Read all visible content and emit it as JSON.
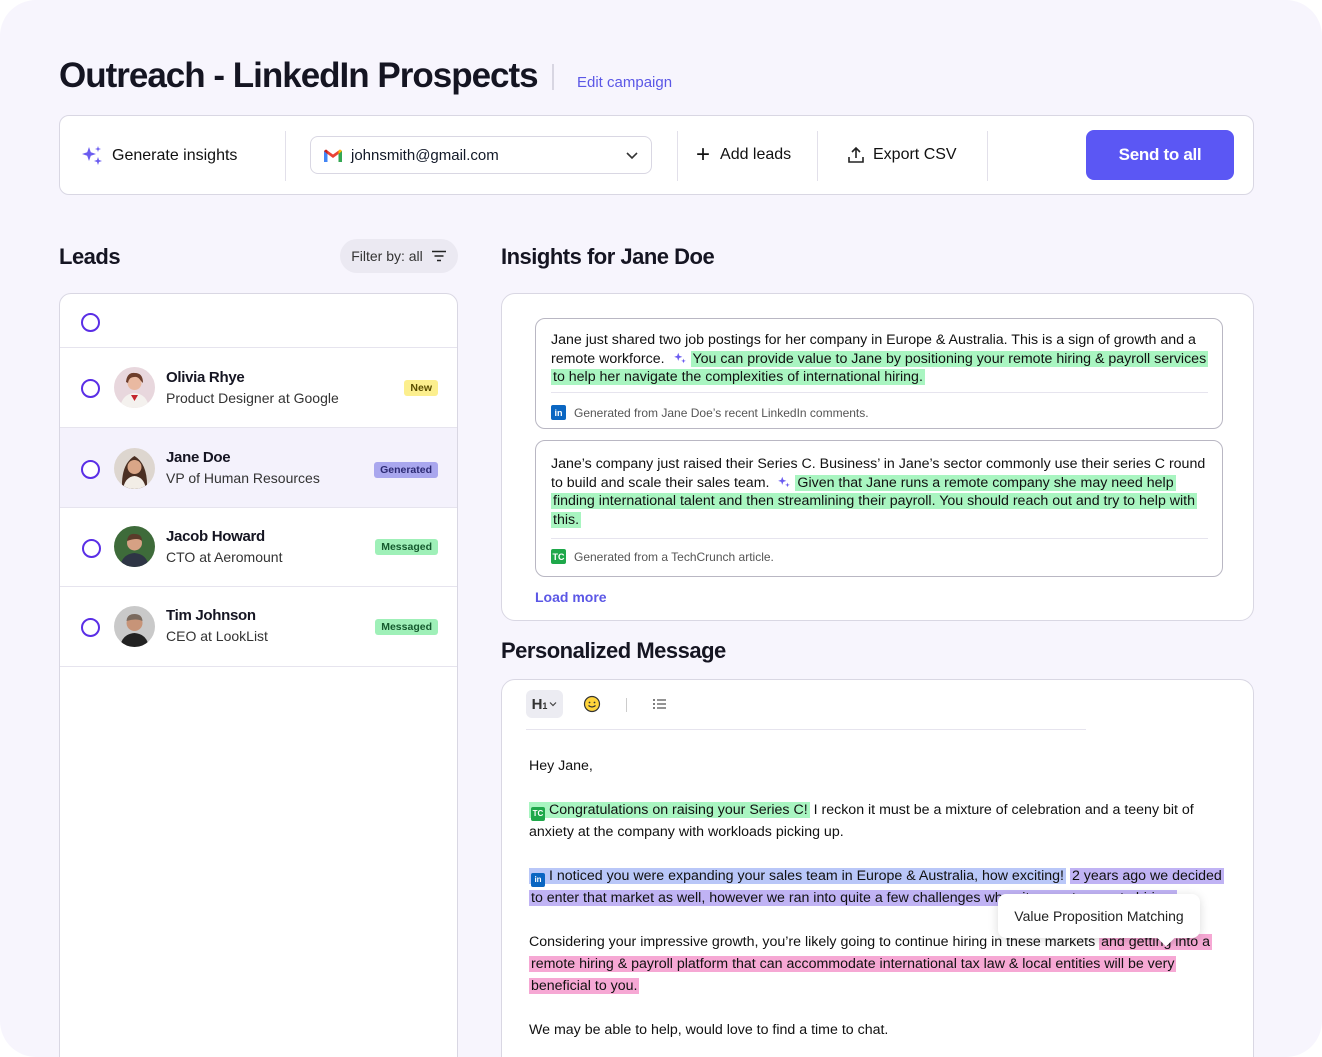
{
  "header": {
    "title": "Outreach - LinkedIn Prospects",
    "edit_link": "Edit campaign"
  },
  "toolbar": {
    "generate_label": "Generate insights",
    "email": "johnsmith@gmail.com",
    "add_leads_label": "Add leads",
    "export_label": "Export CSV",
    "send_label": "Send to all"
  },
  "leads": {
    "heading": "Leads",
    "filter_label": "Filter by: all",
    "items": [
      {
        "name": "Olivia Rhye",
        "role": "Product Designer at Google",
        "badge": "New",
        "badge_color": "#fcef8e"
      },
      {
        "name": "Jane Doe",
        "role": "VP of Human Resources",
        "badge": "Generated",
        "badge_color": "#a9a7ee"
      },
      {
        "name": "Jacob Howard",
        "role": "CTO at Aeromount",
        "badge": "Messaged",
        "badge_color": "#9ff0b8"
      },
      {
        "name": "Tim Johnson",
        "role": "CEO at LookList",
        "badge": "Messaged",
        "badge_color": "#9ff0b8"
      }
    ]
  },
  "insights": {
    "heading": "Insights for Jane Doe",
    "cards": [
      {
        "text": "Jane just shared two job postings for her company in Europe & Australia. This is a sign of growth and a remote workforce.",
        "highlight": "You can provide value to Jane by positioning your remote hiring & payroll services to help her navigate the complexities of international hiring.",
        "source": "Generated from Jane Doe’s recent LinkedIn comments.",
        "source_icon": "linkedin-icon"
      },
      {
        "text": "Jane’s company just raised their Series C. Business’ in Jane’s sector commonly use their series C round to build and scale their sales team.",
        "highlight": "Given that Jane runs a remote company she may need help finding international talent and then streamlining their payroll. You should reach out and try to help with this.",
        "source": "Generated from a TechCrunch article.",
        "source_icon": "techcrunch-icon"
      }
    ],
    "load_more": "Load more"
  },
  "message": {
    "heading": "Personalized Message",
    "toolbar": {
      "heading_tool": "H",
      "heading_sub": "1"
    },
    "greeting": "Hey Jane,",
    "p1_highlight": "Congratulations on raising your Series C!",
    "p1_rest": "I reckon it must be a mixture of celebration and a teeny bit of anxiety at the company with workloads picking up.",
    "p2_highlight_blue": "I noticed you were expanding your sales team in Europe & Australia, how exciting!",
    "p2_highlight_purple": "2 years ago we decided to enter that market as well, however we ran into quite a few challenges when it came to remote hiring.",
    "p3_plain": "Considering your impressive growth, you’re likely going to continue hiring in these markets",
    "p3_highlight": "and getting into a remote hiring & payroll platform that can accommodate international tax law & local entities will be very beneficial to you.",
    "p4": "We may be able to help, would love to find a time to chat.",
    "tooltip": "Value Proposition Matching"
  },
  "colors": {
    "accent": "#5b57f4",
    "highlight_green": "#a9f5c1",
    "highlight_blue": "#b9c7f8",
    "highlight_purple": "#c0b3f4",
    "highlight_pink": "#f6a8d4"
  }
}
